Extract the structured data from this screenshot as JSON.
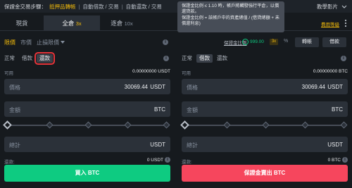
{
  "topbar": {
    "steps_label": "保證金交易步驟：",
    "steps": [
      "抵押品轉帳",
      "自動借款 / 交易",
      "自動還款 / 交易"
    ],
    "tutorial_label": "教學影片"
  },
  "tabs": [
    {
      "label": "現貨",
      "leverage": ""
    },
    {
      "label": "全倉",
      "leverage": "3x"
    },
    {
      "label": "逐倉",
      "leverage": "10x"
    }
  ],
  "fee_link": "費用等級",
  "tooltip": {
    "line1": "保證金比例 ≤ 1.10 時，帳戶將觸發強行平倉，以償還貸款。",
    "line2": "保證金比例 = 該帳戶中的資產總值 / (借貸總額 + 未償還利息)"
  },
  "order_types": {
    "limit": "限價",
    "market": "市價",
    "stop_limit": "止損限價"
  },
  "margin_info": {
    "margin_level_label": "保證金比例",
    "margin_level_value": "999.00",
    "leverage_badge": "3x",
    "pct_icon_text": "%"
  },
  "buttons": {
    "transfer": "轉帳",
    "borrow": "借款"
  },
  "left_panel": {
    "modes": [
      "正常",
      "借款",
      "還款"
    ],
    "available_label": "可用",
    "available_value": "0.00000000 USDT",
    "price_label": "價格",
    "price_value": "30069.44",
    "price_unit": "USDT",
    "amount_label": "金額",
    "amount_unit": "BTC",
    "total_label": "總計",
    "total_unit": "USDT",
    "repay_label": "還款:",
    "repay_value": "0 USDT",
    "action_label": "買入 BTC"
  },
  "right_panel": {
    "modes": [
      "正常",
      "借款",
      "還款"
    ],
    "available_label": "可用",
    "available_value": "0.00000000 BTC",
    "price_label": "價格",
    "price_value": "30069.44",
    "price_unit": "USDT",
    "amount_label": "金額",
    "amount_unit": "BTC",
    "total_label": "總計",
    "total_unit": "USDT",
    "repay_label": "還款:",
    "repay_value": "0 BTC",
    "action_label": "保證金賣出 BTC"
  },
  "slider_position": 0,
  "colors": {
    "accent": "#f0b90b",
    "buy": "#0ecb81",
    "sell": "#f6465d",
    "highlight_box": "#e6343a"
  }
}
